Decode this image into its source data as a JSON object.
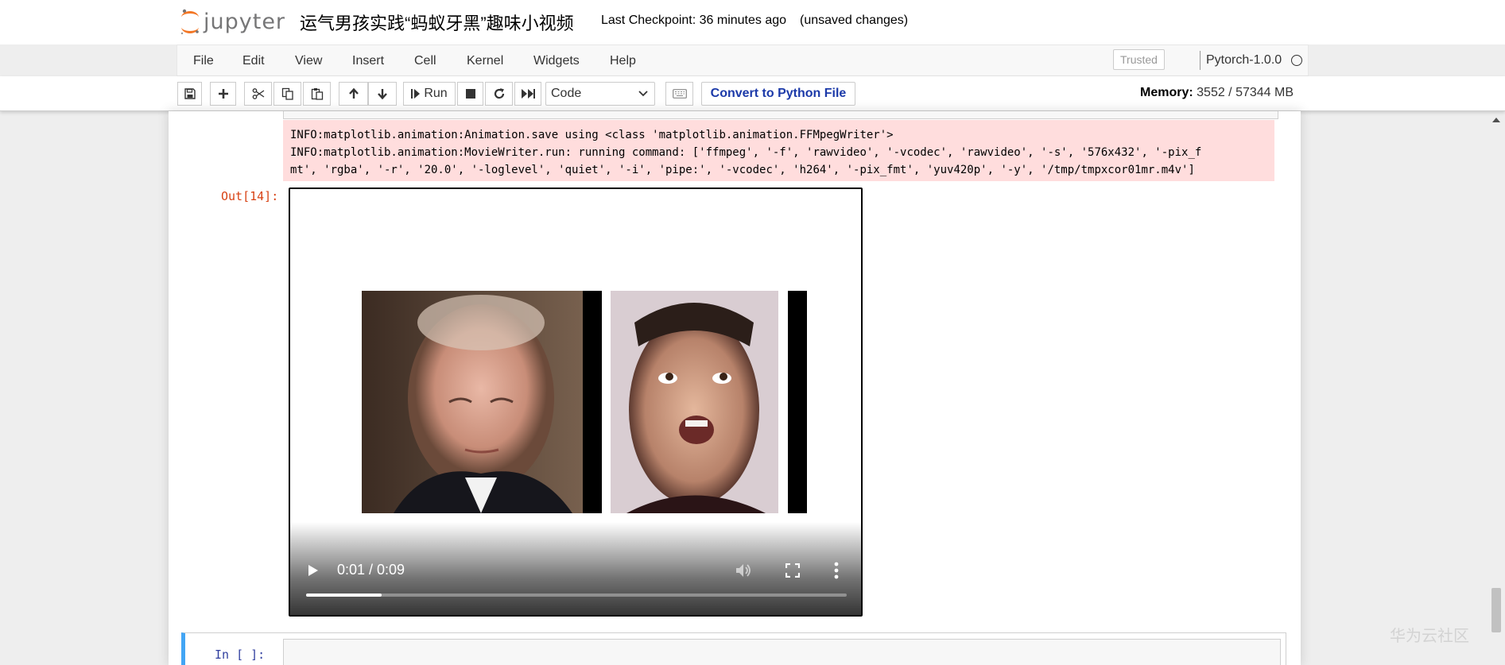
{
  "header": {
    "logo_text": "jupyter",
    "title": "运气男孩实践“蚂蚁牙黑”趣味小视频",
    "checkpoint": "Last Checkpoint: 36 minutes ago",
    "autosave": "(unsaved changes)"
  },
  "menubar": {
    "items": [
      "File",
      "Edit",
      "View",
      "Insert",
      "Cell",
      "Kernel",
      "Widgets",
      "Help"
    ],
    "trusted": "Trusted",
    "kernel_name": "Pytorch-1.0.0"
  },
  "toolbar": {
    "run_label": "Run",
    "cell_type": "Code",
    "convert_label": "Convert to Python File",
    "memory_label": "Memory:",
    "memory_value": "3552 / 57344 MB",
    "icons": [
      "save-icon",
      "plus-icon",
      "cut-icon",
      "copy-icon",
      "paste-icon",
      "arrow-up-icon",
      "arrow-down-icon",
      "run-icon",
      "stop-icon",
      "restart-icon",
      "fast-forward-icon",
      "keyboard-icon"
    ]
  },
  "output": {
    "stderr_lines": [
      "INFO:matplotlib.animation:Animation.save using <class 'matplotlib.animation.FFMpegWriter'>",
      "INFO:matplotlib.animation:MovieWriter.run: running command: ['ffmpeg', '-f', 'rawvideo', '-vcodec', 'rawvideo', '-s', '576x432', '-pix_f",
      "mt', 'rgba', '-r', '20.0', '-loglevel', 'quiet', '-i', 'pipe:', '-vcodec', 'h264', '-pix_fmt', 'yuv420p', '-y', '/tmp/tmpxcor01mr.m4v']"
    ],
    "out_prompt": "Out[14]:",
    "video": {
      "time": "0:01 / 0:09",
      "progress_fraction": 0.14
    }
  },
  "next_cell": {
    "prompt": "In  [ ]:"
  },
  "watermark": "华为云社区"
}
